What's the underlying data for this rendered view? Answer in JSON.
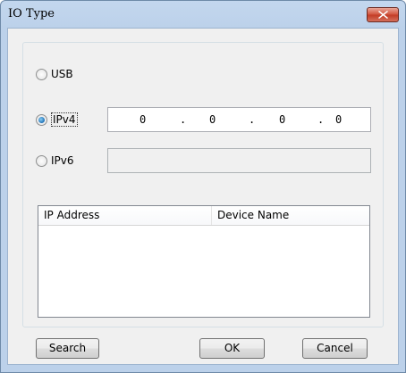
{
  "window": {
    "title": "IO Type",
    "close_icon": "close-x"
  },
  "io_options": {
    "usb_label": "USB",
    "ipv4_label": "IPv4",
    "ipv6_label": "IPv6",
    "selected": "IPv4"
  },
  "ipv4": {
    "octets": [
      "0",
      "0",
      "0",
      "0"
    ],
    "separator": "."
  },
  "ipv6": {
    "value": ""
  },
  "device_list": {
    "columns": [
      "IP Address",
      "Device Name"
    ],
    "rows": []
  },
  "buttons": {
    "search": "Search",
    "ok": "OK",
    "cancel": "Cancel"
  },
  "colors": {
    "close_button": "#c7432c",
    "title_gradient": "#bcd1ea",
    "radio_selected": "#1e6fb5"
  }
}
